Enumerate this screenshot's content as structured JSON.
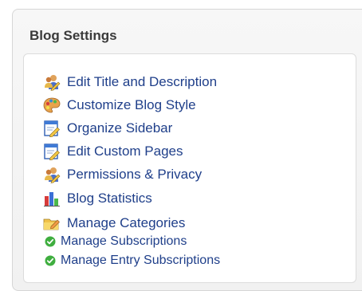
{
  "panel": {
    "title": "Blog Settings"
  },
  "settings": {
    "items": [
      {
        "label": "Edit Title and Description",
        "icon": "people-pencil-icon"
      },
      {
        "label": "Customize Blog Style",
        "icon": "palette-icon"
      },
      {
        "label": "Organize Sidebar",
        "icon": "window-pencil-icon"
      },
      {
        "label": "Edit Custom Pages",
        "icon": "window-pencil-icon"
      },
      {
        "label": "Permissions & Privacy",
        "icon": "people-pencil-icon"
      },
      {
        "label": "Blog Statistics",
        "icon": "bar-chart-icon"
      },
      {
        "label": "Manage Categories",
        "icon": "folder-pencil-icon"
      },
      {
        "label": "Manage Subscriptions",
        "icon": "green-check-icon"
      },
      {
        "label": "Manage Entry Subscriptions",
        "icon": "green-check-icon"
      }
    ]
  },
  "colors": {
    "link": "#1f3f8a",
    "title": "#3a3a3a",
    "panel_border": "#d6d6d6",
    "check_green": "#3fae3f"
  }
}
